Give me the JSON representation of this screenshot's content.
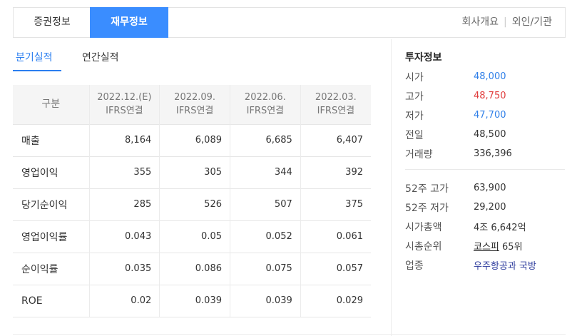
{
  "top_tabs": [
    "증권정보",
    "재무정보"
  ],
  "top_links": [
    "회사개요",
    "외인/기관"
  ],
  "sub_tabs": [
    "분기실적",
    "연간실적"
  ],
  "table": {
    "header_label": "구분",
    "columns": [
      {
        "period": "2022.12.(E)",
        "basis": "IFRS연결"
      },
      {
        "period": "2022.09.",
        "basis": "IFRS연결"
      },
      {
        "period": "2022.06.",
        "basis": "IFRS연결"
      },
      {
        "period": "2022.03.",
        "basis": "IFRS연결"
      }
    ],
    "rows": [
      {
        "label": "매출",
        "values": [
          "8,164",
          "6,089",
          "6,685",
          "6,407"
        ]
      },
      {
        "label": "영업이익",
        "values": [
          "355",
          "305",
          "344",
          "392"
        ]
      },
      {
        "label": "당기순이익",
        "values": [
          "285",
          "526",
          "507",
          "375"
        ]
      },
      {
        "label": "영업이익률",
        "values": [
          "0.043",
          "0.05",
          "0.052",
          "0.061"
        ]
      },
      {
        "label": "순이익률",
        "values": [
          "0.035",
          "0.086",
          "0.075",
          "0.057"
        ]
      },
      {
        "label": "ROE",
        "values": [
          "0.02",
          "0.039",
          "0.039",
          "0.029"
        ]
      }
    ]
  },
  "invest": {
    "title": "투자정보",
    "price": [
      {
        "label": "시가",
        "value": "48,000",
        "color": "#2f7fe8"
      },
      {
        "label": "고가",
        "value": "48,750",
        "color": "#e03c3c"
      },
      {
        "label": "저가",
        "value": "47,700",
        "color": "#2f7fe8"
      },
      {
        "label": "전일",
        "value": "48,500",
        "color": "#333333"
      },
      {
        "label": "거래량",
        "value": "336,396",
        "color": "#333333"
      }
    ],
    "week52_high_label": "52주 고가",
    "week52_high": "63,900",
    "week52_low_label": "52주 저가",
    "week52_low": "29,200",
    "market_cap_label": "시가총액",
    "market_cap": "4조 6,642억",
    "rank_label": "시총순위",
    "rank_market": "코스피",
    "rank_value": "65위",
    "industry_label": "업종",
    "industry": "우주항공과 국방"
  }
}
